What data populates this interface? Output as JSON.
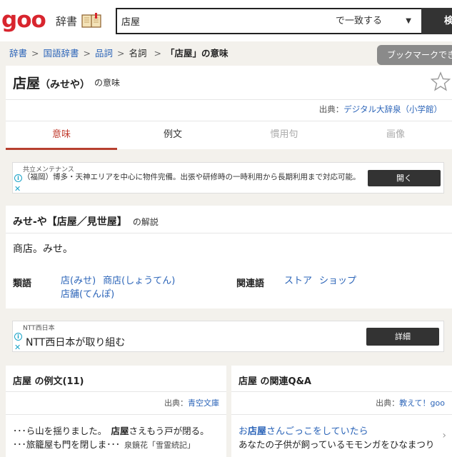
{
  "header": {
    "logo": "goo",
    "dict_label": "辞書",
    "search_value": "店屋",
    "match_mode": "で一致する",
    "search_button": "検索"
  },
  "breadcrumb": {
    "items": [
      "辞書",
      "国語辞書",
      "品詞",
      "名詞"
    ],
    "current": "「店屋」の意味"
  },
  "bookmark_tooltip": "ブックマークできます",
  "entry": {
    "headword": "店屋",
    "reading": "（みせや）",
    "imi": "の意味",
    "source_prefix": "出典：",
    "source": "デジタル大辞泉（小学館）"
  },
  "tabs": [
    "意味",
    "例文",
    "慣用句",
    "画像"
  ],
  "ad1": {
    "sponsor": "共立メンテナンス",
    "text": "（福岡）博多・天神エリアを中心に物件完備。出張や研修時の一時利用から長期利用まで対応可能。",
    "button": "開く"
  },
  "definition": {
    "heading": "みせ-や【店屋／見世屋】",
    "kaisetsu": "の解説",
    "body": "商店。みせ。",
    "synonym_label": "類語",
    "synonyms": [
      "店(みせ)",
      "商店(しょうてん)",
      "店舗(てんぽ)"
    ],
    "related_label": "関連語",
    "related": [
      "ストア",
      "ショップ"
    ]
  },
  "ad2": {
    "sponsor": "NTT西日本",
    "text": "NTT西日本が取り組む",
    "button": "詳細"
  },
  "examples": {
    "title": "店屋 の例文(11)",
    "source_prefix": "出典：",
    "source": "青空文庫",
    "line1_pre": "･･･ら山を揺りました。　",
    "line1_kw": "店屋",
    "line1_post": "さえもう戸が閉る。",
    "line2": "･･･旅籠屋も門を閉しま･･･",
    "line2_src": "泉鏡花「雪霊続記」"
  },
  "qa": {
    "title": "店屋 の関連Q&A",
    "source_prefix": "出典：",
    "source": "教えて！goo",
    "q_pre": "お",
    "q_kw": "店屋",
    "q_post": "さんごっこをしていたら",
    "a": "あなたの子供が飼っているモモンガをひなまつり"
  }
}
